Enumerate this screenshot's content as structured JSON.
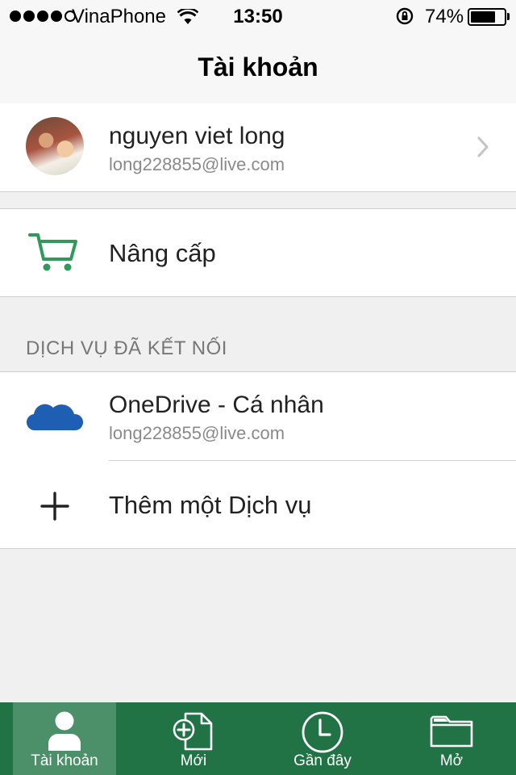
{
  "status_bar": {
    "carrier": "VinaPhone",
    "time": "13:50",
    "battery_percent": "74%",
    "battery_level": 0.74,
    "signal_bars": 4,
    "signal_max": 5
  },
  "header": {
    "title": "Tài khoản"
  },
  "profile": {
    "name": "nguyen viet long",
    "email": "long228855@live.com"
  },
  "upgrade": {
    "label": "Nâng cấp",
    "icon": "cart-icon",
    "icon_color": "#217346"
  },
  "services": {
    "section_title": "DỊCH VỤ ĐÃ KẾT NỐI",
    "items": [
      {
        "name": "OneDrive - Cá nhân",
        "email": "long228855@live.com",
        "icon": "onedrive-cloud-icon",
        "icon_color": "#1e5fb4"
      }
    ],
    "add_label": "Thêm một Dịch vụ"
  },
  "tab_bar": {
    "background": "#217346",
    "tabs": [
      {
        "label": "Tài khoản",
        "icon": "person-icon",
        "active": true
      },
      {
        "label": "Mới",
        "icon": "new-document-icon",
        "active": false
      },
      {
        "label": "Gần đây",
        "icon": "clock-icon",
        "active": false
      },
      {
        "label": "Mở",
        "icon": "folder-icon",
        "active": false
      }
    ]
  }
}
